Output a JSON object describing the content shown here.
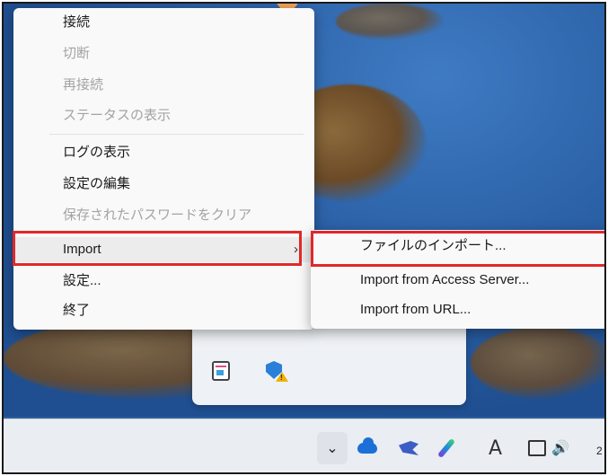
{
  "context_menu": {
    "items": [
      {
        "label": "接続",
        "enabled": true
      },
      {
        "label": "切断",
        "enabled": false
      },
      {
        "label": "再接続",
        "enabled": false
      },
      {
        "label": "ステータスの表示",
        "enabled": false
      },
      {
        "label": "ログの表示",
        "enabled": true
      },
      {
        "label": "設定の編集",
        "enabled": true
      },
      {
        "label": "保存されたパスワードをクリア",
        "enabled": false
      },
      {
        "label": "Import",
        "enabled": true,
        "has_submenu": true
      },
      {
        "label": "設定...",
        "enabled": true
      },
      {
        "label": "終了",
        "enabled": true
      }
    ],
    "submenu_chevron": "›"
  },
  "import_submenu": {
    "items": [
      {
        "label": "ファイルのインポート..."
      },
      {
        "label": "Import from Access Server..."
      },
      {
        "label": "Import from URL..."
      }
    ]
  },
  "taskbar": {
    "overflow_chevron": "⌄",
    "ime_indicator": "A",
    "volume_glyph": "🔊",
    "clock_partial": "2",
    "icons": [
      "onedrive-cloud-icon",
      "bird-app-icon",
      "pen-app-icon",
      "network-icon",
      "volume-icon"
    ]
  },
  "colors": {
    "highlight_box": "#e0282a",
    "menu_bg": "#f9f9f9",
    "disabled_text": "#a3a3a3"
  }
}
